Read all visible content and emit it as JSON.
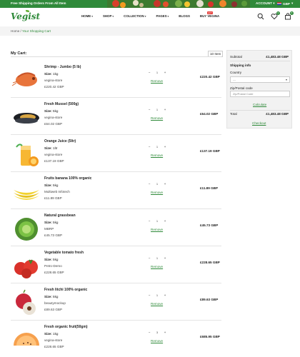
{
  "topbar": {
    "promo": "Free Shipping Orders From All Item",
    "account": "ACCOUNT",
    "currency": "GBP"
  },
  "header": {
    "logo": "Vegist",
    "nav": [
      {
        "label": "HOME",
        "caret": "▾"
      },
      {
        "label": "SHOP",
        "caret": "▾"
      },
      {
        "label": "COLLECTION",
        "caret": "▾"
      },
      {
        "label": "PAGES",
        "caret": "▾"
      },
      {
        "label": "BLOGS",
        "caret": ""
      },
      {
        "label": "BUY VEGINA",
        "caret": ""
      }
    ],
    "hot_badge": "HOT",
    "wishlist_count": "0",
    "cart_count": "8"
  },
  "breadcrumb": {
    "home": "Home",
    "separator": "/",
    "current": "Your Shopping Cart"
  },
  "cart": {
    "title": "My Cart:",
    "item_count": "10 Item",
    "remove_label": "Remove",
    "size_label": "Size:",
    "items": [
      {
        "name": "Shrimp - Jumbo (5 lb)",
        "size": "1kg",
        "vendor": "vegina-store",
        "unit_price": "£220.42 GBP",
        "qty": "1",
        "line_total": "£220.42 GBP",
        "icon": "shrimp-icon"
      },
      {
        "name": "Fresh Mussel (500g)",
        "size": "5kg",
        "vendor": "vegina-store",
        "unit_price": "£64.02 GBP",
        "qty": "1",
        "line_total": "£64.02 GBP",
        "icon": "mussel-icon"
      },
      {
        "name": "Orange Juice (5ltr)",
        "size": "1ltr",
        "vendor": "vegina-store",
        "unit_price": "£137.19 GBP",
        "qty": "1",
        "line_total": "£137.19 GBP",
        "icon": "orange-juice-icon"
      },
      {
        "name": "Fruits banana 100% organic",
        "size": "5kg",
        "vendor": "Multiweb Infotech",
        "unit_price": "£11.89 GBP",
        "qty": "1",
        "line_total": "£11.89 GBP",
        "icon": "banana-icon"
      },
      {
        "name": "Natural grassbean",
        "size": "5kg",
        "vendor": "MBRP",
        "unit_price": "£45.73 GBP",
        "qty": "1",
        "line_total": "£45.73 GBP",
        "icon": "cabbage-icon"
      },
      {
        "name": "Vegetable tomato fresh",
        "size": "5kg",
        "vendor": "Petro-Demo",
        "unit_price": "£228.65 GBP",
        "qty": "1",
        "line_total": "£228.65 GBP",
        "icon": "tomato-icon"
      },
      {
        "name": "Fresh litchi 100% organic",
        "size": "5kg",
        "vendor": "beautymockup",
        "unit_price": "£89.63 GBP",
        "qty": "1",
        "line_total": "£89.63 GBP",
        "icon": "litchi-icon"
      },
      {
        "name": "Fresh organic fruit(50gm)",
        "size": "1kg",
        "vendor": "vegina-store",
        "unit_price": "£228.65 GBP",
        "qty": "3",
        "line_total": "£685.95 GBP",
        "icon": "melon-icon"
      }
    ]
  },
  "summary": {
    "subtotal_label": "Subtotal",
    "subtotal_value": "£1,483.48 GBP",
    "shipping_title": "Shipping info",
    "country_label": "Country",
    "country_value": "---",
    "zip_label": "Zip/Postal code",
    "zip_placeholder": "Zip/Postal Code",
    "calculate": "Calculate",
    "total_label": "Total",
    "total_value": "£1,483.48 GBP",
    "checkout": "Checkout"
  },
  "colors": {
    "brand": "#2f8a3a",
    "hot": "#e53935"
  }
}
